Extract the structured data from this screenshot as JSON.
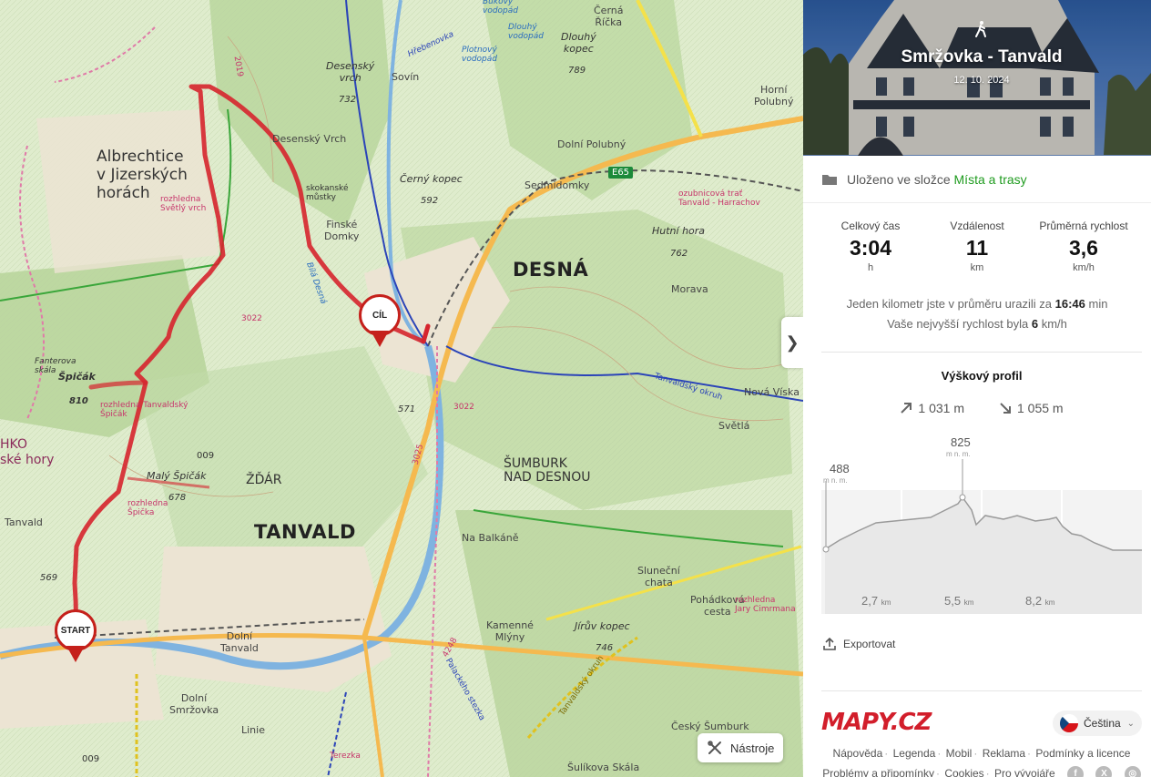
{
  "map": {
    "towns_big": [
      "DESNÁ",
      "TANVALD"
    ],
    "towns": [
      "Albrechtice\nv Jizerských\nhorách",
      "ŠUMBURK\nNAD DESNOU",
      "ŽĎÁR"
    ],
    "villages": [
      "Desenský Vrch",
      "Sovín",
      "Dolní Polubný",
      "Sedmidomky",
      "Morava",
      "Nová Víska",
      "Světlá",
      "Na Balkáně",
      "Sluneční\nchata",
      "Pohádková\ncesta",
      "Kamenné\nMlýny",
      "Dolní\nTanvald",
      "Dolní\nSmržovka",
      "Český Šumburk",
      "Šulíkova Skála",
      "Linie",
      "Horní\nPolubný",
      "Černá\nŘíčka",
      "Finské\nDomky",
      "skokanské\nmůstky",
      "Fanterova\nskála",
      "Tanvald",
      "Terezka"
    ],
    "peaks": [
      {
        "name": "Desenský\nvrch",
        "elev": "732"
      },
      {
        "name": "Dlouhý\nkopec",
        "elev": "789"
      },
      {
        "name": "Černý kopec",
        "elev": "592"
      },
      {
        "name": "Hutní hora",
        "elev": "762"
      },
      {
        "name": "Malý Špičák",
        "elev": "678"
      },
      {
        "name": "Jírův kopec",
        "elev": "746"
      },
      {
        "name": "Špičák",
        "elev": "810"
      }
    ],
    "elev_points": [
      "571",
      "569",
      "009",
      "009"
    ],
    "pois": [
      "rozhledna\nSvětlý vrch",
      "rozhledna Tanvaldský\nŠpičák",
      "rozhledna\nŠpička",
      "ozubnicová trať\nTanvald - Harrachov",
      "Jary Cimrmana",
      "rozhledna"
    ],
    "water": [
      "Bukový\nvodopád",
      "Dlouhý\nvodopád",
      "Plotnový\nvodopád",
      "Bílá Desná",
      "Hřebenovka",
      "Tanvaldský okruh",
      "Palackého stezka",
      "Tanvaldský okruh"
    ],
    "road_badge": "E65",
    "route_numbers": [
      "2019",
      "3022",
      "3025",
      "3022",
      "4248"
    ],
    "region": [
      "HKO",
      "ské hory"
    ],
    "pin_finish": "CÍL",
    "pin_start": "START",
    "tools_label": "Nástroje",
    "collapse_label": "❯"
  },
  "panel": {
    "title": "Smržovka - Tanvald",
    "date": "12. 10. 2024",
    "folder_prefix": "Uloženo ve složce",
    "folder_link": "Místa a trasy",
    "stats": [
      {
        "label": "Celkový čas",
        "value": "3:04",
        "unit": "h"
      },
      {
        "label": "Vzdálenost",
        "value": "11",
        "unit": "km"
      },
      {
        "label": "Průměrná rychlost",
        "value": "3,6",
        "unit": "km/h"
      }
    ],
    "pace_prefix": "Jeden kilometr jste v průměru urazili za",
    "pace_value": "16:46",
    "pace_unit": "min",
    "max_speed_prefix": "Vaše nejvyšší rychlost byla",
    "max_speed_value": "6",
    "max_speed_unit": "km/h",
    "elevation": {
      "title": "Výškový profil",
      "ascent": "1 031 m",
      "descent": "1 055 m",
      "start_label": "488",
      "peak_label": "825",
      "unit_label": "m n. m.",
      "axis_ticks": [
        {
          "value": "2,7",
          "unit": "km"
        },
        {
          "value": "5,5",
          "unit": "km"
        },
        {
          "value": "8,2",
          "unit": "km"
        }
      ]
    },
    "export_label": "Exportovat",
    "logo": "MAPY.CZ",
    "language": "Čeština",
    "footer_links_row1": [
      "Nápověda",
      "Legenda",
      "Mobil",
      "Reklama",
      "Podmínky a licence"
    ],
    "footer_links_row2": [
      "Problémy a připomínky",
      "Cookies",
      "Pro vývojáře"
    ],
    "social": [
      "f",
      "X",
      "◎"
    ]
  },
  "colors": {
    "route": "#d6252e",
    "accent_green": "#1f9b1f",
    "brand_red": "#d21e2b",
    "map_base": "#dfeccd"
  }
}
